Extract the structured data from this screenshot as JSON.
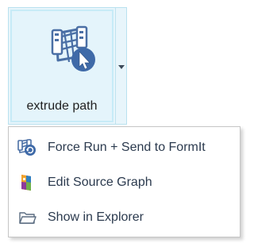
{
  "ribbon_button": {
    "label": "extrude path",
    "icon": "extrude-path-graph-icon"
  },
  "menu": {
    "items": [
      {
        "label": "Force Run + Send to FormIt",
        "icon": "force-run-icon"
      },
      {
        "label": "Edit Source Graph",
        "icon": "dynamo-graph-icon"
      },
      {
        "label": "Show in Explorer",
        "icon": "folder-icon"
      }
    ]
  },
  "colors": {
    "button_hover_bg": "#e4f4fb",
    "button_border": "#b9e1ef",
    "icon_blue": "#4a6fa5",
    "text": "#2b3a4e"
  }
}
